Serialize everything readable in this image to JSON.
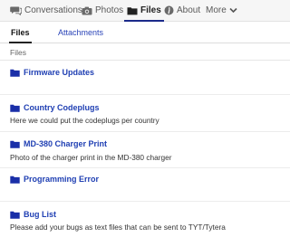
{
  "nav": {
    "items": [
      {
        "label": "Conversations",
        "icon": "conversations-icon"
      },
      {
        "label": "Photos",
        "icon": "camera-icon"
      },
      {
        "label": "Files",
        "icon": "folder-icon",
        "active": true
      },
      {
        "label": "About",
        "icon": "info-icon"
      },
      {
        "label": "More",
        "icon": "chevron-down-icon"
      }
    ]
  },
  "subtabs": [
    {
      "label": "Files",
      "active": true
    },
    {
      "label": "Attachments",
      "active": false
    }
  ],
  "breadcrumb": "Files",
  "folders": [
    {
      "name": "Firmware Updates",
      "description": ""
    },
    {
      "name": "Country Codeplugs",
      "description": "Here we could put the codeplugs per country"
    },
    {
      "name": "MD-380 Charger Print",
      "description": "Photo of the charger print in the MD-380 charger"
    },
    {
      "name": "Programming Error",
      "description": ""
    },
    {
      "name": "Bug List",
      "description": "Please add your bugs as text files that can be sent to TYT/Tytera"
    }
  ],
  "colors": {
    "accent": "#1b2a8a",
    "link": "#1f3fb3",
    "folder_icon": "#1a2fa8"
  }
}
